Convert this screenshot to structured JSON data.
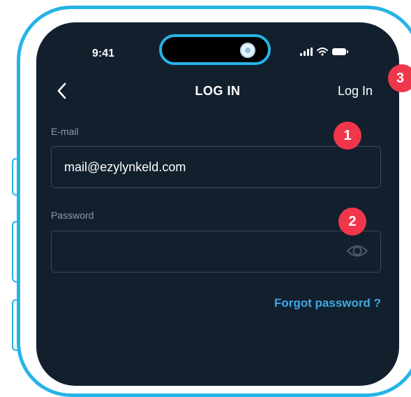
{
  "status_bar": {
    "time": "9:41"
  },
  "header": {
    "title": "LOG IN",
    "login_action": "Log In",
    "back_icon": "chevron-left-icon"
  },
  "form": {
    "email": {
      "label": "E-mail",
      "value": "mail@ezylynkeld.com"
    },
    "password": {
      "label": "Password",
      "value": "",
      "toggle_icon": "eye-icon"
    },
    "forgot_link": "Forgot password ?"
  },
  "annotations": {
    "badge_1": "1",
    "badge_2": "2",
    "badge_3": "3"
  },
  "colors": {
    "screen_bg": "#12202e",
    "frame": "#27b3e6",
    "accent_link": "#3fa9e4",
    "badge": "#f0364b"
  }
}
